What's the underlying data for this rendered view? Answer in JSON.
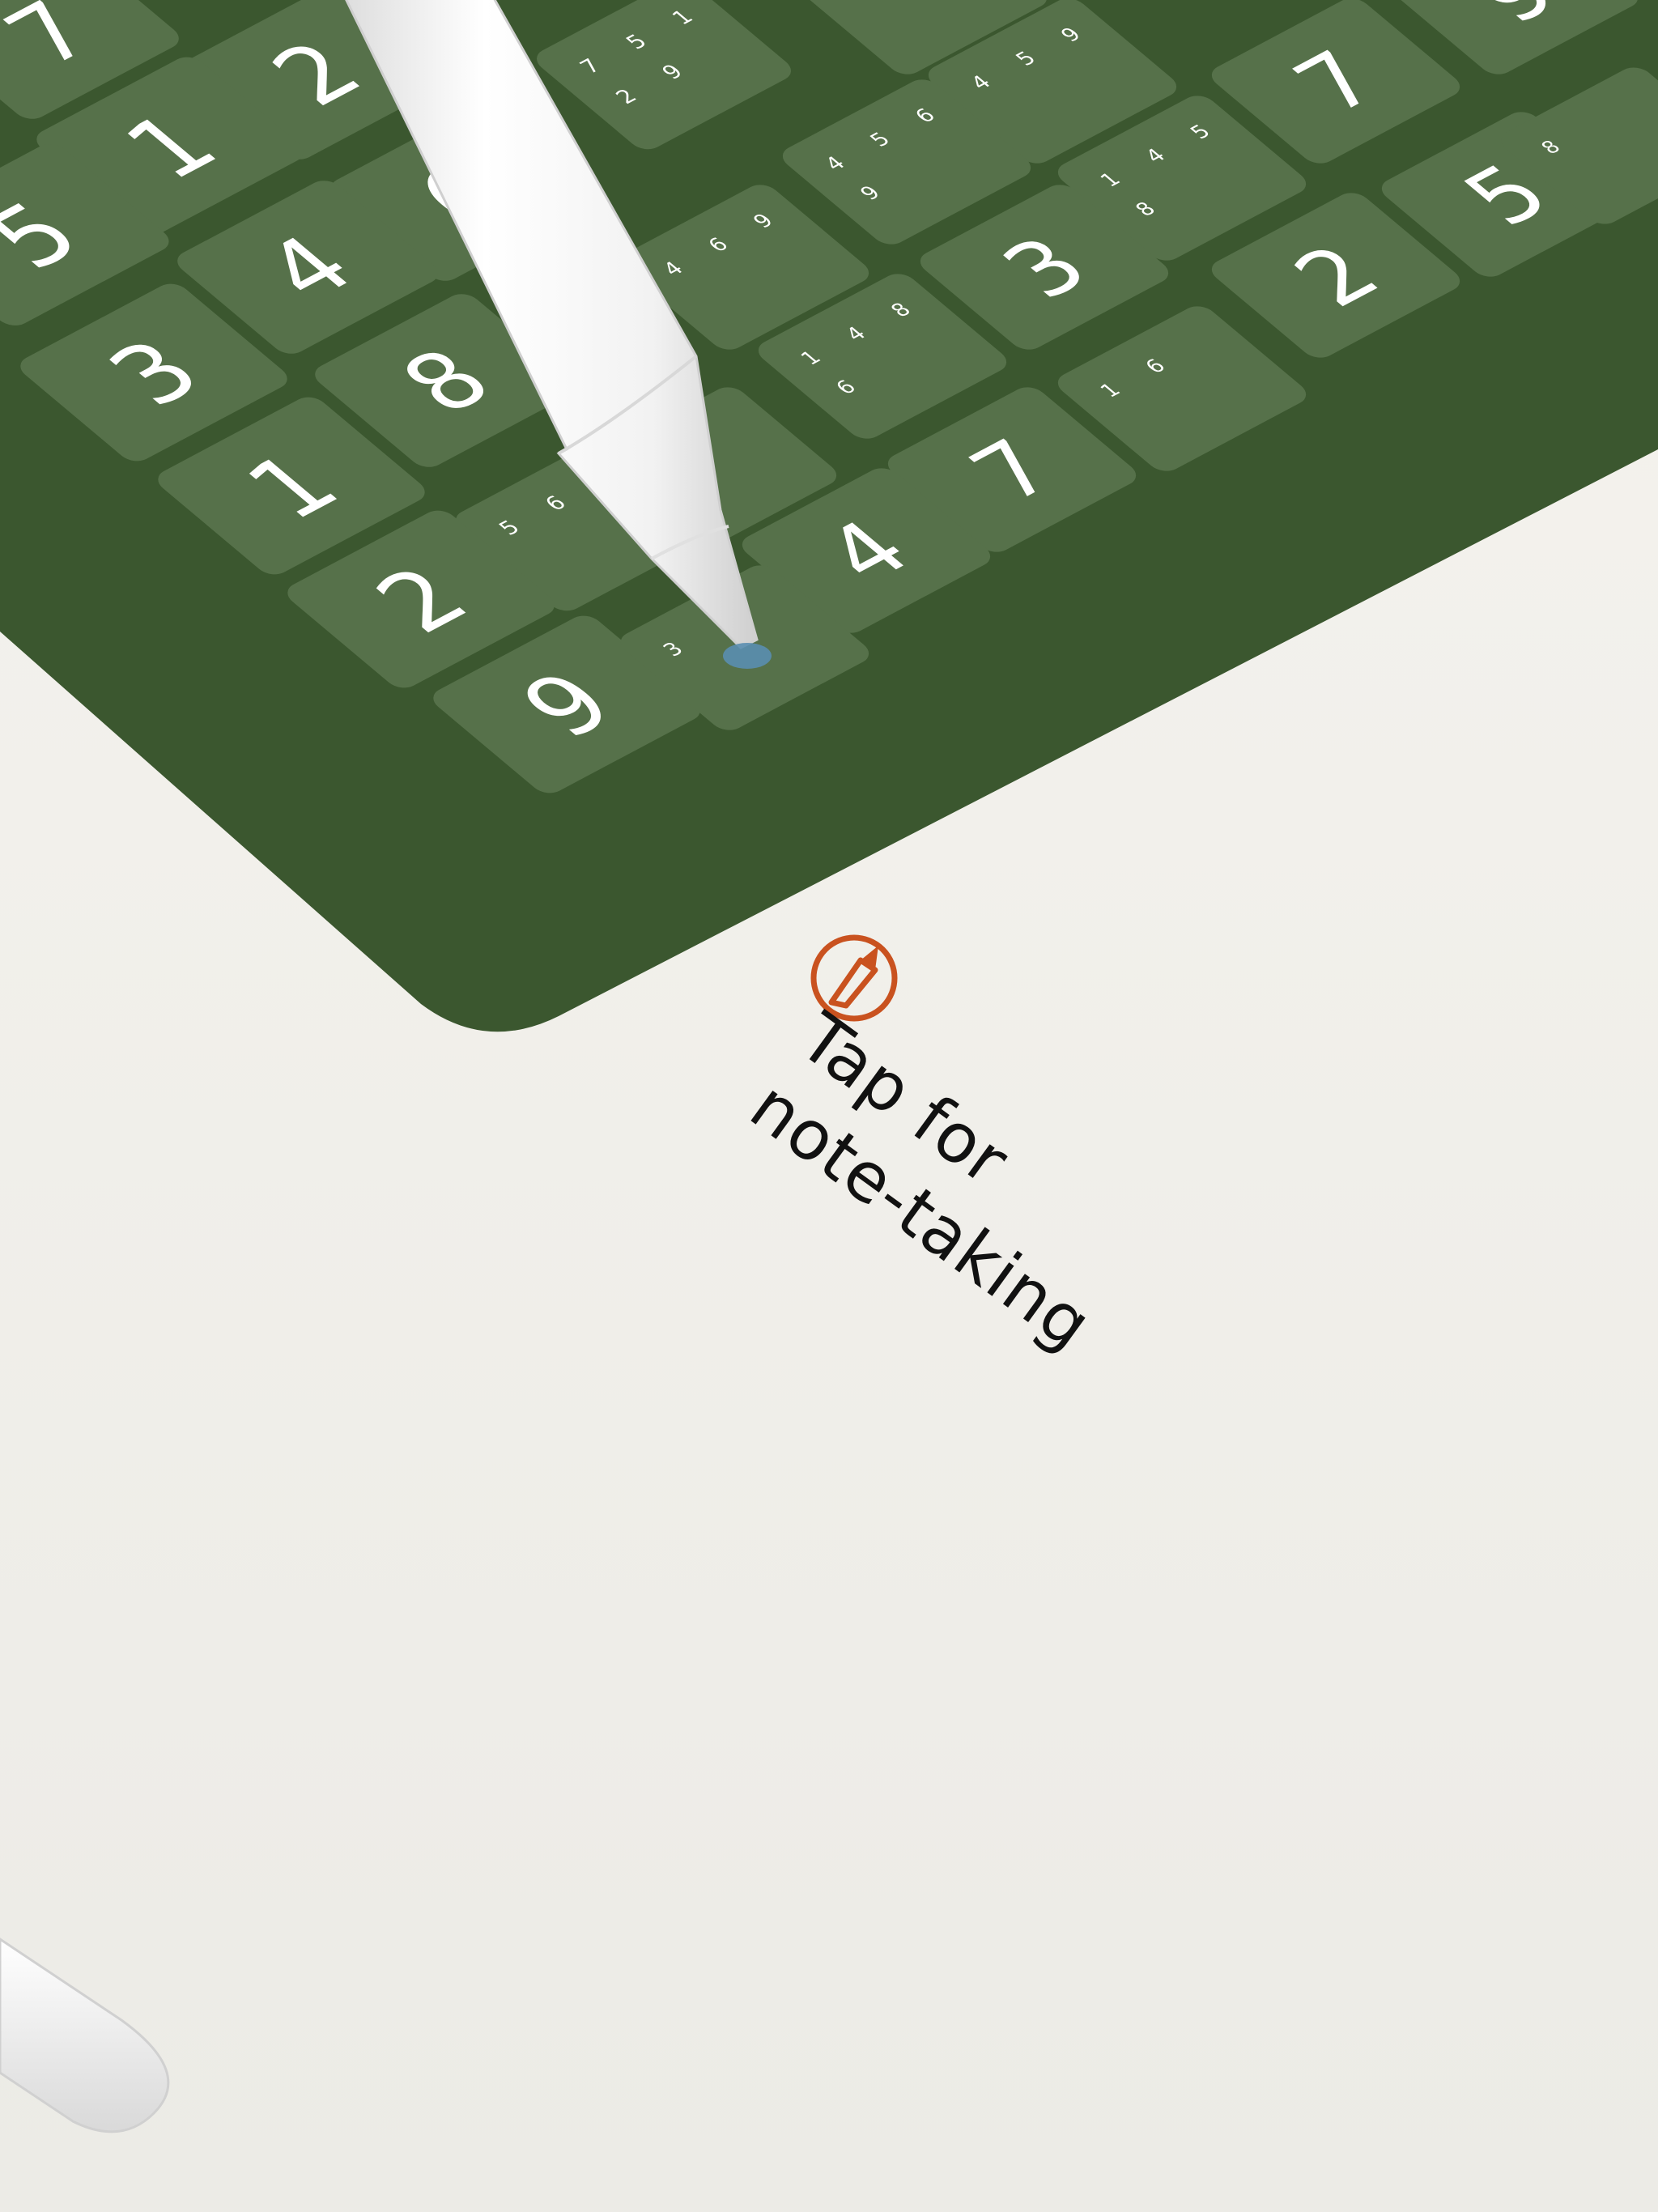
{
  "colors": {
    "board": "#3b572f",
    "cell": "#56714a",
    "cell_ink": "#ffffff",
    "note_icon": "#c9521f",
    "pencil_tip": "#5a8eb0",
    "background": "#f3f1ec"
  },
  "caption": {
    "line1": "Tap for",
    "line2": "note-taking"
  },
  "icons": {
    "note_mode": "pencil-in-circle-icon",
    "pencil": "apple-pencil",
    "pencil_tip": "pencil-tip-marker-icon"
  },
  "cells": [
    {
      "id": "c0",
      "big": "7"
    },
    {
      "id": "c1",
      "big": "2"
    },
    {
      "id": "c2",
      "notes": [
        "7",
        "5",
        "1",
        "2",
        "9"
      ]
    },
    {
      "id": "c3",
      "notes": [
        "9"
      ]
    },
    {
      "id": "c4",
      "notes": [
        "4",
        "5",
        "9"
      ]
    },
    {
      "id": "c5",
      "big": "7"
    },
    {
      "id": "c6",
      "big": "9"
    },
    {
      "id": "c7",
      "big": "1"
    },
    {
      "id": "c8",
      "big": "6"
    },
    {
      "id": "c9",
      "notes": [
        "4",
        "5",
        "6",
        "9"
      ]
    },
    {
      "id": "c10",
      "notes": [
        "1",
        "4",
        "5",
        "8"
      ]
    },
    {
      "id": "c11",
      "big": "5"
    },
    {
      "id": "c12",
      "notes": [
        "8"
      ]
    },
    {
      "id": "c13",
      "big": "5"
    },
    {
      "id": "c14",
      "big": "4"
    },
    {
      "id": "c15",
      "notes": [
        "4",
        "6",
        "9"
      ]
    },
    {
      "id": "c16",
      "big": "3"
    },
    {
      "id": "c17",
      "big": "2"
    },
    {
      "id": "c18",
      "big": "3"
    },
    {
      "id": "c19",
      "big": "8"
    },
    {
      "id": "c20",
      "notes": [
        "1",
        "4",
        "8",
        "6"
      ]
    },
    {
      "id": "c21",
      "notes": [
        "1",
        "6"
      ]
    },
    {
      "id": "c22",
      "big": "1"
    },
    {
      "id": "c23",
      "notes": [
        "5",
        "6"
      ]
    },
    {
      "id": "c24",
      "notes": [
        "5",
        "6"
      ]
    },
    {
      "id": "c25",
      "big": "7"
    },
    {
      "id": "c26",
      "big": "2"
    },
    {
      "id": "c27",
      "big": "4"
    },
    {
      "id": "c28",
      "big": "9"
    },
    {
      "id": "c29",
      "notes": [
        "3"
      ]
    }
  ]
}
